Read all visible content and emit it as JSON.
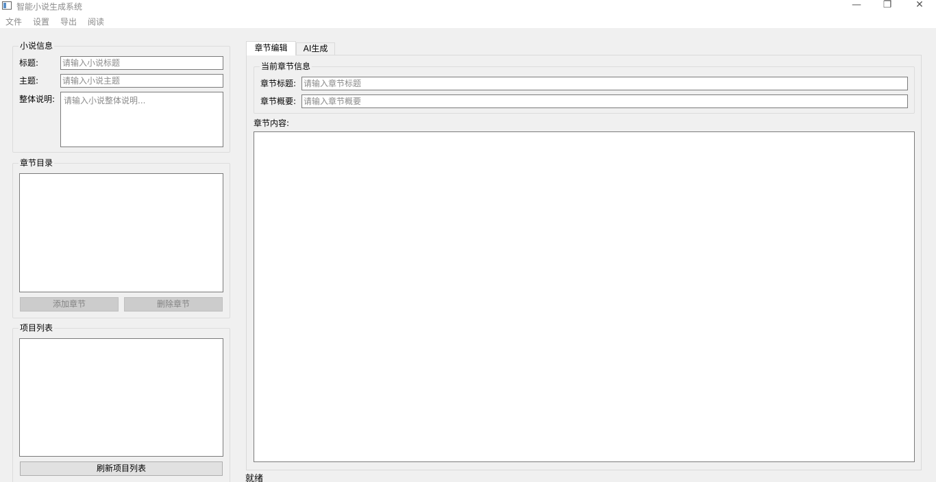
{
  "window": {
    "title": "智能小说生成系统",
    "minimize_glyph": "—",
    "maximize_glyph": "❐",
    "close_glyph": "✕"
  },
  "menu": {
    "items": [
      "文件",
      "设置",
      "导出",
      "阅读"
    ]
  },
  "novel_info": {
    "group_title": "小说信息",
    "title_label": "标题:",
    "title_placeholder": "请输入小说标题",
    "theme_label": "主题:",
    "theme_placeholder": "请输入小说主题",
    "description_label": "整体说明:",
    "description_placeholder": "请输入小说整体说明..."
  },
  "chapters": {
    "group_title": "章节目录",
    "add_label": "添加章节",
    "delete_label": "删除章节"
  },
  "projects": {
    "group_title": "项目列表",
    "refresh_label": "刷新项目列表"
  },
  "tabs": {
    "chapter_edit": "章节编辑",
    "ai_generate": "AI生成"
  },
  "chapter_info": {
    "group_title": "当前章节信息",
    "title_label": "章节标题:",
    "title_placeholder": "请输入章节标题",
    "summary_label": "章节概要:",
    "summary_placeholder": "请输入章节概要",
    "content_label": "章节内容:"
  },
  "status": "就绪",
  "colors": {
    "background": "#f0f0f0",
    "border": "#7a7a7a",
    "placeholder": "#8a8a8a",
    "disabled_button": "#cccccc"
  }
}
